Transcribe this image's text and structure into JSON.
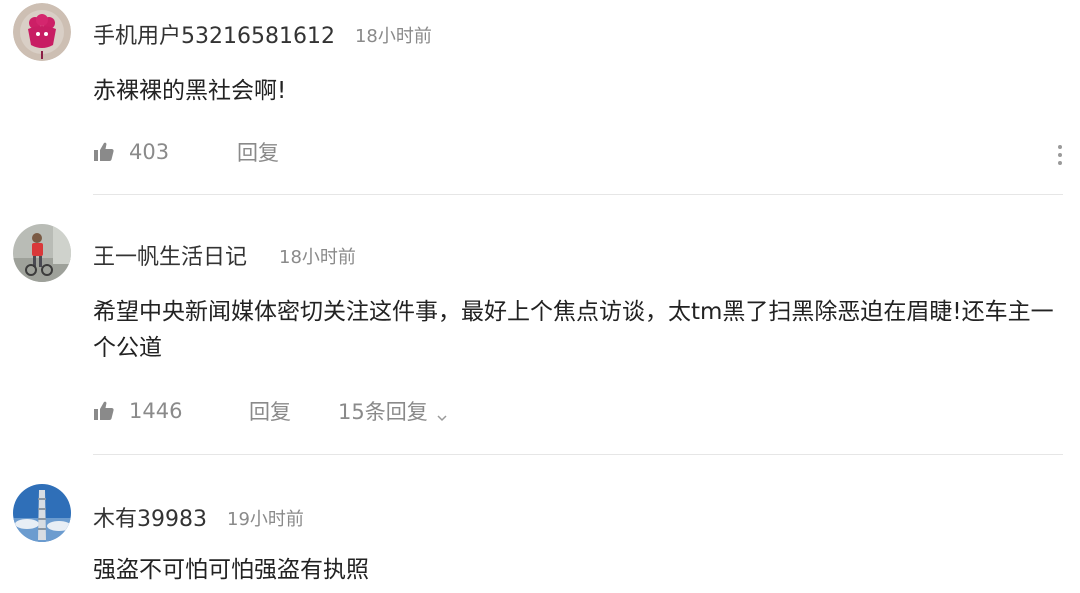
{
  "comments": [
    {
      "username": "手机用户53216581612",
      "time": "18小时前",
      "content": "赤裸裸的黑社会啊!",
      "likes": "403",
      "reply_label": "回复",
      "avatar": "pink-flower-avatar"
    },
    {
      "username": "王一帆生活日记",
      "time": "18小时前",
      "content": "希望中央新闻媒体密切关注这件事，最好上个焦点访谈，太tm黑了扫黑除恶迫在眉睫!还车主一个公道",
      "likes": "1446",
      "reply_label": "回复",
      "replies_label": "15条回复",
      "avatar": "child-photo-avatar"
    },
    {
      "username": "木有39983",
      "time": "19小时前",
      "content": "强盗不可怕可怕强盗有执照",
      "avatar": "tower-photo-avatar"
    }
  ],
  "icons": {
    "like": "thumbs-up-icon",
    "more": "more-vertical-icon",
    "expand": "chevron-down-icon"
  },
  "colors": {
    "text_primary": "#222222",
    "text_secondary": "#8a8a8a",
    "divider": "#e6e6e6"
  }
}
